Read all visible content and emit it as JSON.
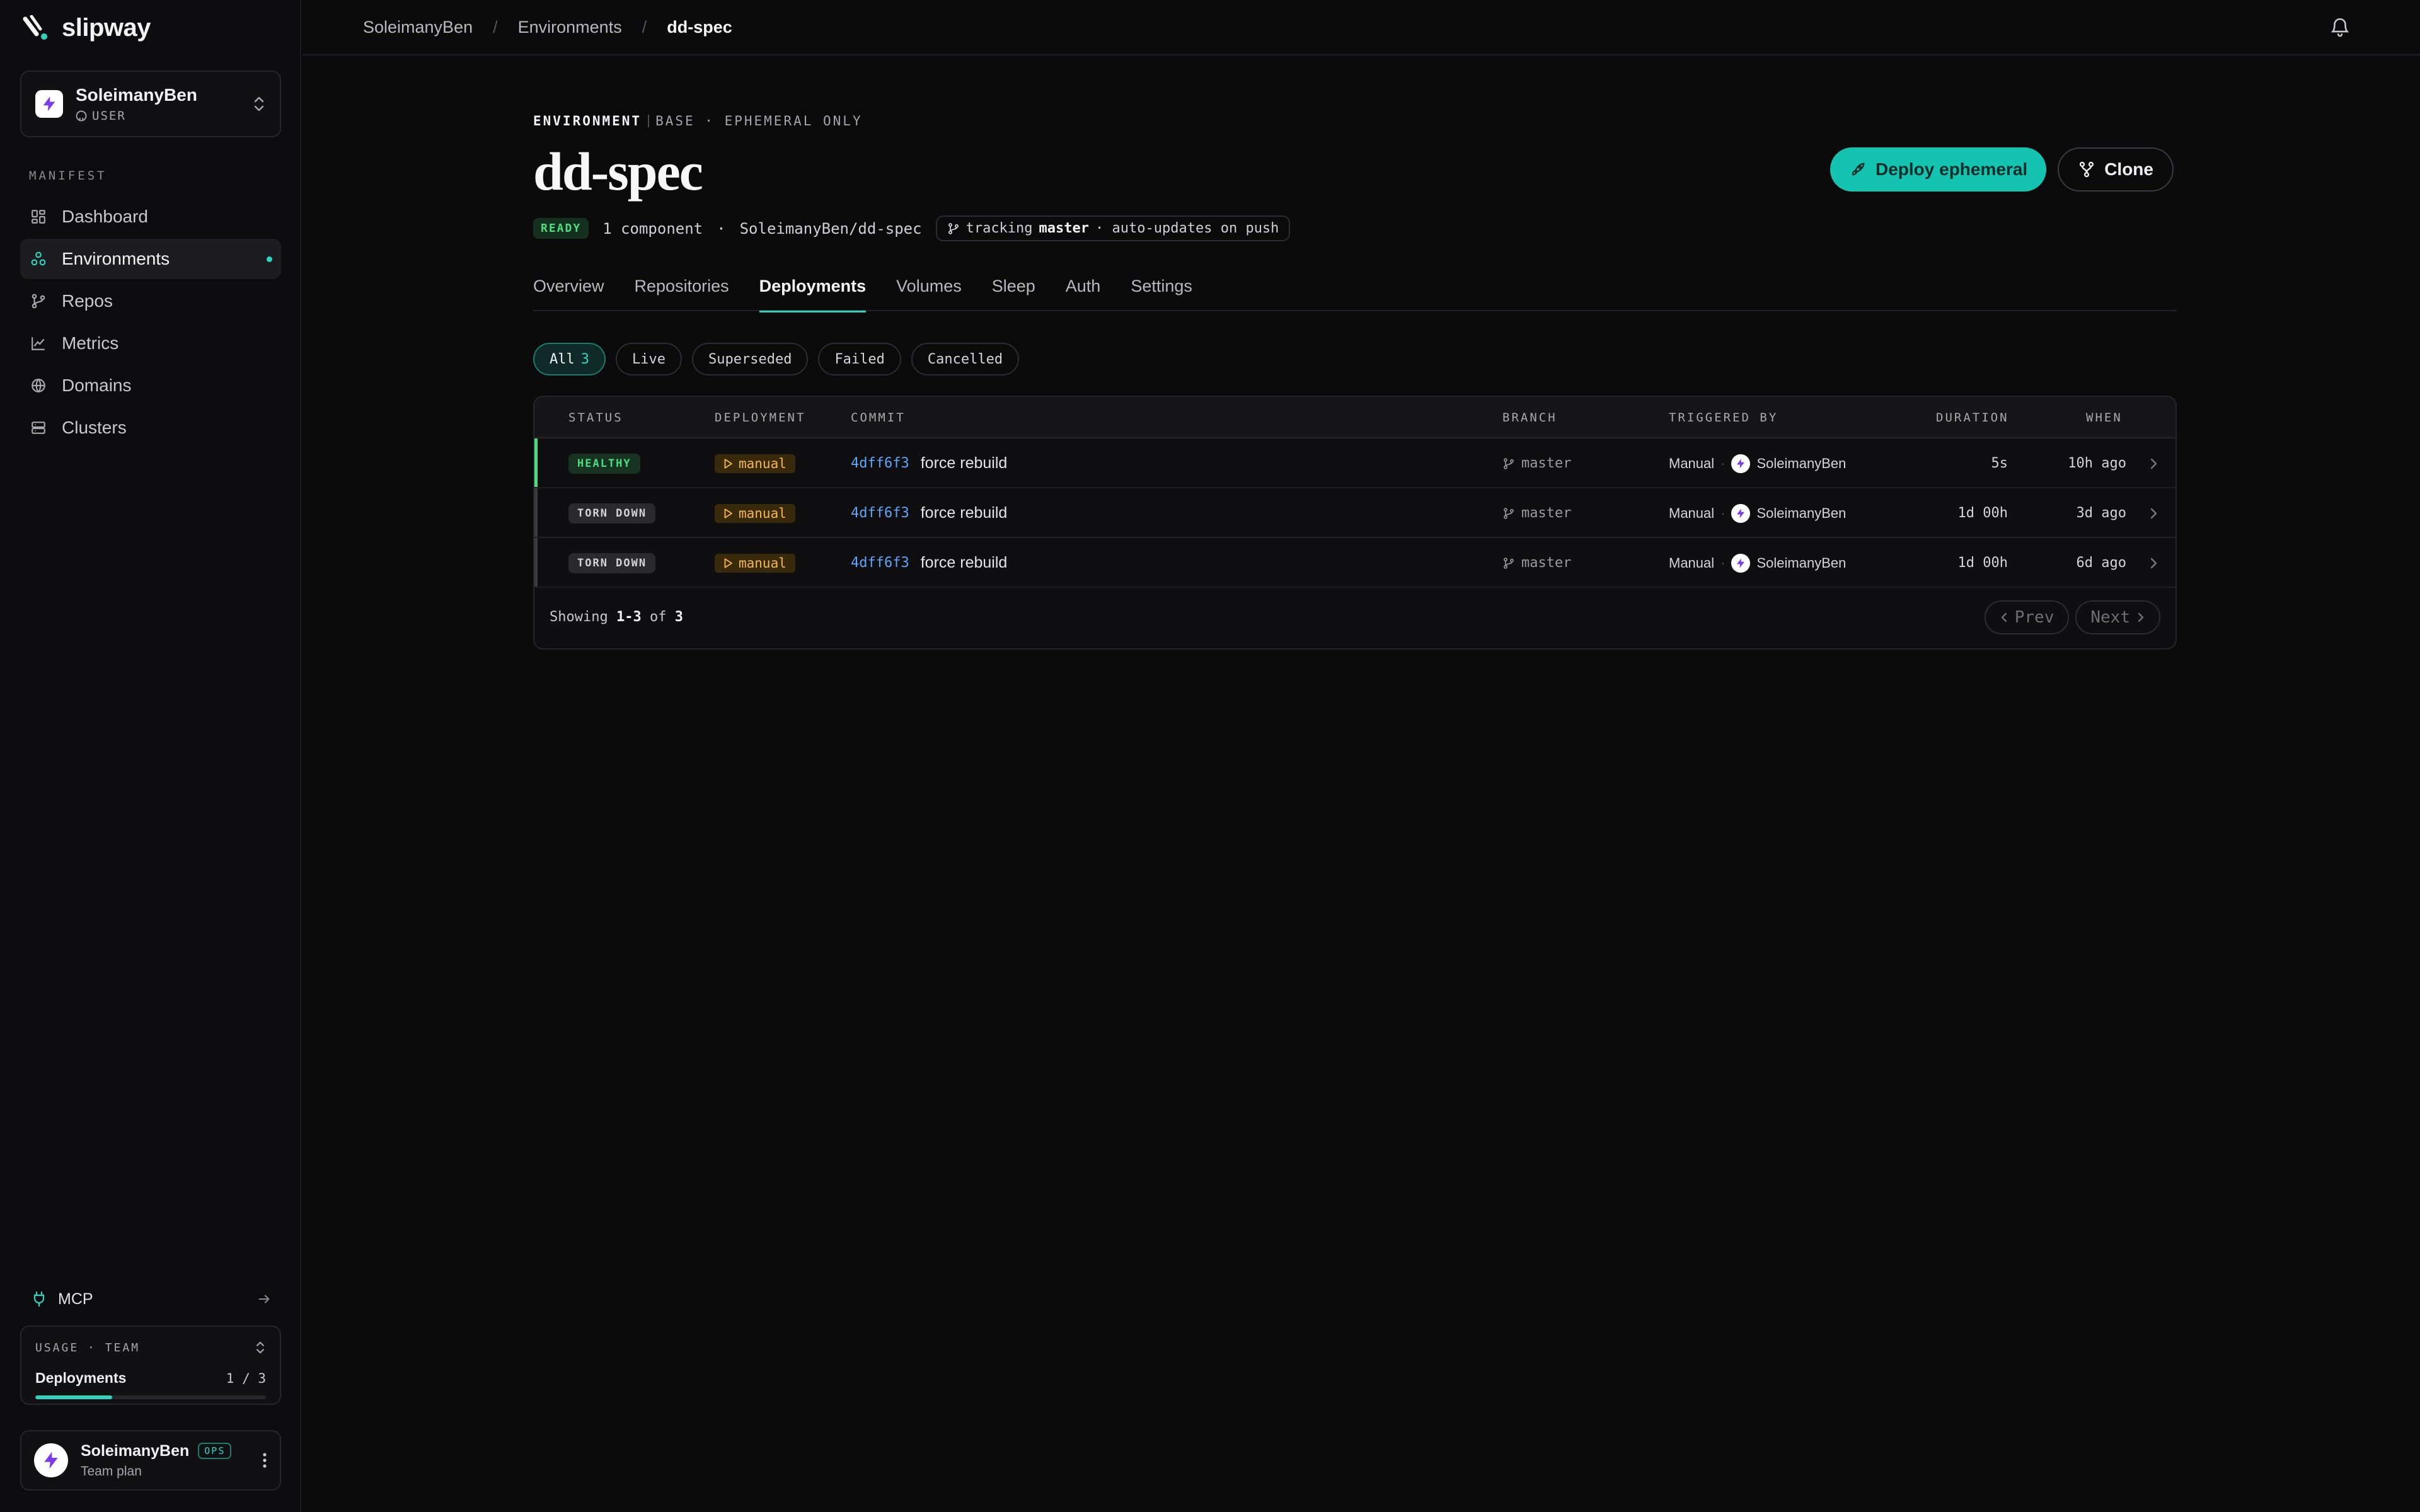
{
  "brand": {
    "name": "slipway",
    "accent": "#14c4b0"
  },
  "account": {
    "name": "SoleimanyBen",
    "role": "USER"
  },
  "sidebar": {
    "section": "MANIFEST",
    "items": [
      {
        "label": "Dashboard",
        "icon": "dashboard-icon"
      },
      {
        "label": "Environments",
        "icon": "environments-icon",
        "active": true
      },
      {
        "label": "Repos",
        "icon": "git-branch-icon"
      },
      {
        "label": "Metrics",
        "icon": "chart-icon"
      },
      {
        "label": "Domains",
        "icon": "globe-icon"
      },
      {
        "label": "Clusters",
        "icon": "server-icon"
      }
    ],
    "mcp": "MCP",
    "usage": {
      "title": "USAGE · TEAM",
      "label": "Deployments",
      "count": "1 / 3",
      "progress": 0.333
    },
    "profile": {
      "name": "SoleimanyBen",
      "badge": "OPS",
      "plan": "Team plan"
    }
  },
  "breadcrumb": [
    "SoleimanyBen",
    "Environments",
    "dd-spec"
  ],
  "env": {
    "kicker": "ENVIRONMENT",
    "kicker_meta": "BASE · EPHEMERAL ONLY",
    "title": "dd-spec",
    "status": "READY",
    "components": "1 component",
    "repo": "SoleimanyBen/dd-spec",
    "tracking_prefix": "tracking",
    "tracking_branch": "master",
    "tracking_suffix": "· auto-updates on push",
    "dot_sep": "·"
  },
  "actions": {
    "deploy": "Deploy ephemeral",
    "clone": "Clone"
  },
  "tabs": [
    "Overview",
    "Repositories",
    "Deployments",
    "Volumes",
    "Sleep",
    "Auth",
    "Settings"
  ],
  "filters": [
    {
      "label": "All",
      "count": "3",
      "active": true
    },
    {
      "label": "Live"
    },
    {
      "label": "Superseded"
    },
    {
      "label": "Failed"
    },
    {
      "label": "Cancelled"
    }
  ],
  "table": {
    "headers": [
      "STATUS",
      "DEPLOYMENT",
      "COMMIT",
      "BRANCH",
      "TRIGGERED BY",
      "DURATION",
      "WHEN"
    ],
    "rows": [
      {
        "status": "HEALTHY",
        "deployment": "manual",
        "sha": "4dff6f3",
        "message": "force rebuild",
        "branch": "master",
        "trigger": "Manual",
        "dot": "·",
        "user": "SoleimanyBen",
        "duration": "5s",
        "when": "10h ago"
      },
      {
        "status": "TORN DOWN",
        "deployment": "manual",
        "sha": "4dff6f3",
        "message": "force rebuild",
        "branch": "master",
        "trigger": "Manual",
        "dot": "·",
        "user": "SoleimanyBen",
        "duration": "1d 00h",
        "when": "3d ago"
      },
      {
        "status": "TORN DOWN",
        "deployment": "manual",
        "sha": "4dff6f3",
        "message": "force rebuild",
        "branch": "master",
        "trigger": "Manual",
        "dot": "·",
        "user": "SoleimanyBen",
        "duration": "1d 00h",
        "when": "6d ago"
      }
    ],
    "footer": {
      "prefix": "Showing",
      "range": "1-3",
      "of": "of",
      "total": "3"
    },
    "pager": {
      "prev": "Prev",
      "next": "Next"
    }
  }
}
